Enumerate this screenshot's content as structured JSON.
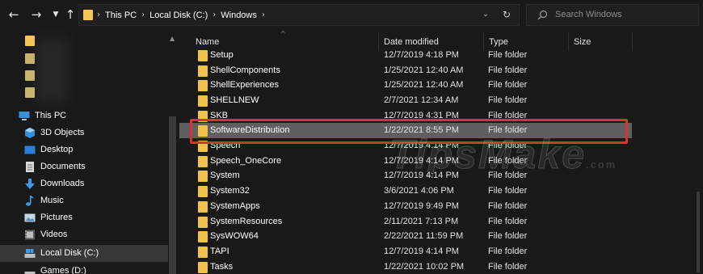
{
  "toolbar": {
    "back_icon": "arrow-left-icon",
    "forward_icon": "arrow-right-icon",
    "recent_icon": "chevron-down-icon",
    "up_icon": "arrow-up-icon"
  },
  "address": {
    "breadcrumbs": [
      "This PC",
      "Local Disk (C:)",
      "Windows"
    ],
    "separator": "›"
  },
  "search": {
    "placeholder": "Search Windows"
  },
  "navigation": {
    "items": [
      {
        "label": "This PC",
        "icon": "pc-icon"
      },
      {
        "label": "3D Objects",
        "icon": "3d-objects-icon"
      },
      {
        "label": "Desktop",
        "icon": "desktop-icon"
      },
      {
        "label": "Documents",
        "icon": "documents-icon"
      },
      {
        "label": "Downloads",
        "icon": "downloads-icon"
      },
      {
        "label": "Music",
        "icon": "music-icon"
      },
      {
        "label": "Pictures",
        "icon": "pictures-icon"
      },
      {
        "label": "Videos",
        "icon": "videos-icon"
      },
      {
        "label": "Local Disk (C:)",
        "icon": "drive-icon",
        "selected": true
      },
      {
        "label": "Games (D:)",
        "icon": "drive-icon"
      }
    ]
  },
  "columns": {
    "name": "Name",
    "date": "Date modified",
    "type": "Type",
    "size": "Size"
  },
  "files": [
    {
      "name": "Setup",
      "date": "12/7/2019 4:18 PM",
      "type": "File folder"
    },
    {
      "name": "ShellComponents",
      "date": "1/25/2021 12:40 AM",
      "type": "File folder"
    },
    {
      "name": "ShellExperiences",
      "date": "1/25/2021 12:40 AM",
      "type": "File folder"
    },
    {
      "name": "SHELLNEW",
      "date": "2/7/2021 12:34 AM",
      "type": "File folder"
    },
    {
      "name": "SKB",
      "date": "12/7/2019 4:31 PM",
      "type": "File folder"
    },
    {
      "name": "SoftwareDistribution",
      "date": "1/22/2021 8:55 PM",
      "type": "File folder",
      "selected": true
    },
    {
      "name": "Speech",
      "date": "12/7/2019 4:14 PM",
      "type": "File folder"
    },
    {
      "name": "Speech_OneCore",
      "date": "12/7/2019 4:14 PM",
      "type": "File folder"
    },
    {
      "name": "System",
      "date": "12/7/2019 4:14 PM",
      "type": "File folder"
    },
    {
      "name": "System32",
      "date": "3/6/2021 4:06 PM",
      "type": "File folder"
    },
    {
      "name": "SystemApps",
      "date": "12/7/2019 9:49 PM",
      "type": "File folder"
    },
    {
      "name": "SystemResources",
      "date": "2/11/2021 7:13 PM",
      "type": "File folder"
    },
    {
      "name": "SysWOW64",
      "date": "2/22/2021 11:59 PM",
      "type": "File folder"
    },
    {
      "name": "TAPI",
      "date": "12/7/2019 4:14 PM",
      "type": "File folder"
    },
    {
      "name": "Tasks",
      "date": "1/22/2021 10:02 PM",
      "type": "File folder"
    }
  ],
  "watermark": {
    "text": "TipsMake",
    "suffix": ".com"
  },
  "colors": {
    "background": "#191919",
    "selected_row": "#5f5f5f",
    "highlight_border": "#d9342b",
    "folder": "#f0c14b"
  }
}
